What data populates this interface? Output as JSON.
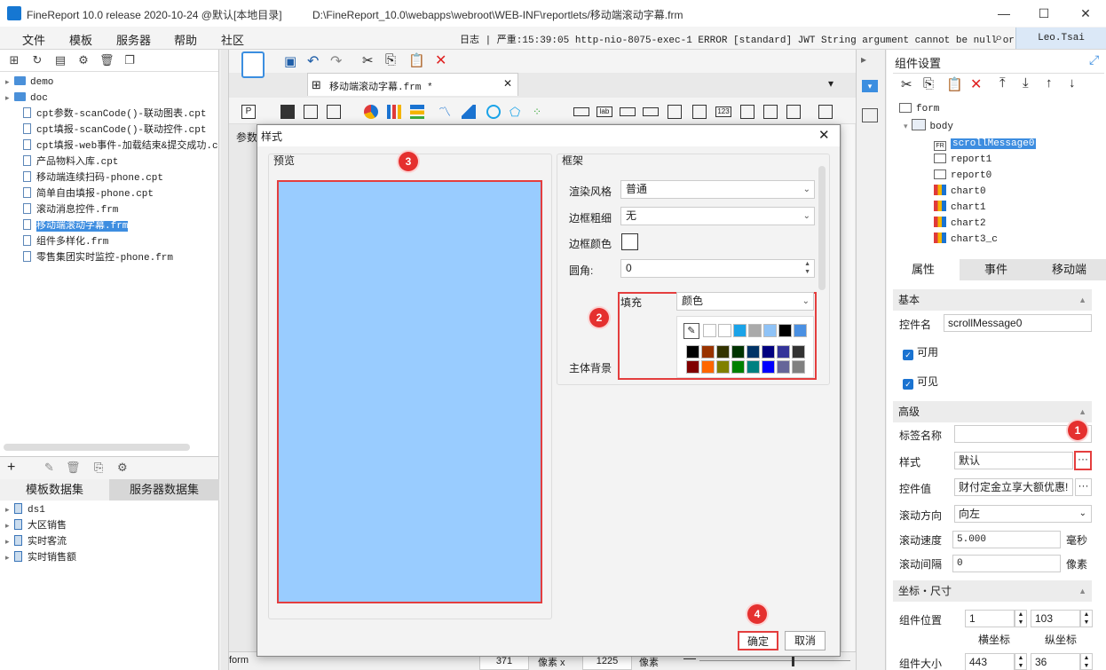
{
  "titlebar": {
    "title": "FineReport 10.0 release 2020-10-24 @默认[本地目录]",
    "path": "D:\\FineReport_10.0\\webapps\\webroot\\WEB-INF\\reportlets/移动端滚动字幕.frm",
    "minimize": "—",
    "maximize": "☐",
    "close": "✕"
  },
  "menubar": {
    "items": [
      "文件",
      "模板",
      "服务器",
      "帮助",
      "社区"
    ],
    "log": "日志 | 严重:15:39:05 http-nio-8075-exec-1 ERROR [standard] JWT String argument cannot be null or ...",
    "user": "Leo.Tsai"
  },
  "left": {
    "tree": [
      {
        "label": "demo",
        "type": "folder"
      },
      {
        "label": "doc",
        "type": "folder"
      },
      {
        "label": "cpt参数-scanCode()-联动图表.cpt",
        "type": "file"
      },
      {
        "label": "cpt填报-scanCode()-联动控件.cpt",
        "type": "file"
      },
      {
        "label": "cpt填报-web事件-加载结束&提交成功.c",
        "type": "file"
      },
      {
        "label": "产品物料入库.cpt",
        "type": "file"
      },
      {
        "label": "移动端连续扫码-phone.cpt",
        "type": "file"
      },
      {
        "label": "简单自由填报-phone.cpt",
        "type": "file"
      },
      {
        "label": "滚动消息控件.frm",
        "type": "file"
      },
      {
        "label": "移动端滚动字幕.frm",
        "type": "file"
      },
      {
        "label": "组件多样化.frm",
        "type": "file"
      },
      {
        "label": "零售集团实时监控-phone.frm",
        "type": "file"
      }
    ],
    "ds_tabs": [
      "模板数据集",
      "服务器数据集"
    ],
    "datasets": [
      "ds1",
      "大区销售",
      "实时客流",
      "实时销售额"
    ]
  },
  "center": {
    "doc_tab": "移动端滚动字幕.frm *",
    "param_label": "参数",
    "status": {
      "x": "371",
      "x_unit": "像素 x",
      "y": "1225",
      "y_unit": "像素"
    },
    "bottom_tab": "form"
  },
  "dialog": {
    "title": "样式",
    "preview_label": "预览",
    "frame_label": "框架",
    "render_style_label": "渲染风格",
    "render_style_value": "普通",
    "border_width_label": "边框粗细",
    "border_width_value": "无",
    "border_color_label": "边框颜色",
    "radius_label": "圆角:",
    "radius_value": "0",
    "fill_label": "填充",
    "fill_value": "颜色",
    "body_bg_label": "主体背景",
    "ok": "确定",
    "cancel": "取消",
    "preview_color": "#99ccff",
    "palette_row1": [
      "#ffffff",
      "#ffffff",
      "#1aa3e8",
      "#aaaaaa",
      "#8fc3f7",
      "#000000",
      "#4a90e2"
    ],
    "palette_row2": [
      "#000000",
      "#993300",
      "#333300",
      "#003300",
      "#003366",
      "#000080",
      "#333399",
      "#333333"
    ],
    "palette_row3": [
      "#800000",
      "#ff6600",
      "#808000",
      "#008000",
      "#008080",
      "#0000ff",
      "#666699",
      "#808080"
    ]
  },
  "right": {
    "header": "组件设置",
    "tree": {
      "root": "form",
      "body": "body",
      "items": [
        "scrollMessage0",
        "report1",
        "report0",
        "chart0",
        "chart1",
        "chart2",
        "chart3_c"
      ]
    },
    "tabs": [
      "属性",
      "事件",
      "移动端"
    ],
    "basic": "基本",
    "name_label": "控件名",
    "name_value": "scrollMessage0",
    "enabled": "可用",
    "visible": "可见",
    "advanced": "高级",
    "tag_label": "标签名称",
    "style_label": "样式",
    "style_value": "默认",
    "value_label": "控件值",
    "value_value": "财付定金立享大额优惠!",
    "direction_label": "滚动方向",
    "direction_value": "向左",
    "speed_label": "滚动速度",
    "speed_value": "5.000",
    "speed_unit": "毫秒",
    "interval_label": "滚动间隔",
    "interval_value": "0",
    "interval_unit": "像素",
    "coord_section": "坐标・尺寸",
    "pos_label": "组件位置",
    "pos_x": "1",
    "pos_y": "103",
    "x_label": "横坐标",
    "y_label": "纵坐标",
    "size_label": "组件大小",
    "size_w": "443",
    "size_h": "36"
  },
  "badges": [
    "1",
    "2",
    "3",
    "4"
  ]
}
